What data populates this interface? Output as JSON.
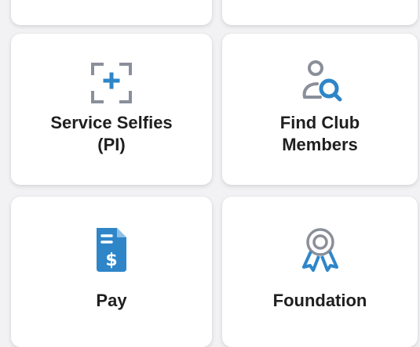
{
  "tiles": {
    "top_left": {
      "label": ""
    },
    "top_right": {
      "label": ""
    },
    "service_selfies": {
      "label": "Service Selfies\n(PI)",
      "icon": "add-photo-frame-icon"
    },
    "find_club_members": {
      "label": "Find Club\nMembers",
      "icon": "person-search-icon"
    },
    "pay": {
      "label": "Pay",
      "icon": "invoice-dollar-icon"
    },
    "foundation": {
      "label": "Foundation",
      "icon": "award-ribbon-icon"
    }
  },
  "colors": {
    "background": "#f2f2f4",
    "card": "#ffffff",
    "icon_gray": "#8a8f9a",
    "icon_blue": "#2e86c9",
    "label_text": "#1f1f1f"
  }
}
